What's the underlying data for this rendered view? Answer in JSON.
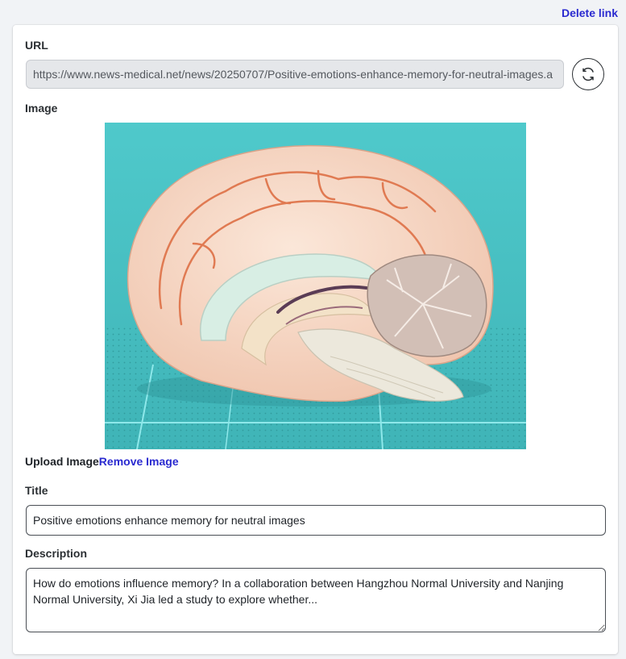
{
  "header": {
    "delete_link": "Delete link"
  },
  "url_section": {
    "label": "URL",
    "value": "https://www.news-medical.net/news/20250707/Positive-emotions-enhance-memory-for-neutral-images.a",
    "refresh_icon": "refresh-icon"
  },
  "image_section": {
    "label": "Image",
    "upload_label": "Upload Image",
    "remove_label": "Remove Image"
  },
  "title_section": {
    "label": "Title",
    "value": "Positive emotions enhance memory for neutral images"
  },
  "description_section": {
    "label": "Description",
    "value": "How do emotions influence memory? In a collaboration between Hangzhou Normal University and Nanjing Normal University, Xi Jia led a study to explore whether..."
  },
  "colors": {
    "link": "#2a2ad0",
    "image_background": "#4cc2c4"
  }
}
